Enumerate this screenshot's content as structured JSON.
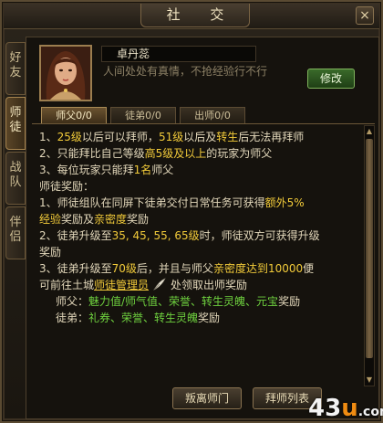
{
  "window": {
    "title": "社 交",
    "close_label": "×"
  },
  "side_tabs": [
    {
      "label": [
        "好",
        "友"
      ]
    },
    {
      "label": [
        "师",
        "徒"
      ]
    },
    {
      "label": [
        "战",
        "队"
      ]
    },
    {
      "label": [
        "伴",
        "侣"
      ]
    }
  ],
  "profile": {
    "name": "卓丹蕊",
    "signature": "人间处处有真情，不抢经验行不行",
    "edit_label": "修改"
  },
  "tabs": [
    {
      "label": "师父0/0"
    },
    {
      "label": "徒弟0/0"
    },
    {
      "label": "出师0/0"
    }
  ],
  "rules": {
    "r1": [
      "1、",
      "25级",
      "以后可以拜师，",
      "51级",
      "以后及",
      "转生",
      "后无法再拜师"
    ],
    "r2": [
      "2、只能拜比自己等级",
      "高5级及以上",
      "的玩家为师父"
    ],
    "r3": [
      "3、每位玩家只能拜",
      "1名",
      "师父"
    ],
    "reward_title": "师徒奖励：",
    "r4": [
      "1、师徒组队在同屏下徒弟交付日常任务可获得",
      "额外5%"
    ],
    "r4b": [
      "经验",
      "奖励及",
      "亲密度",
      "奖励"
    ],
    "r5": [
      "2、徒弟升级至",
      "35, 45, 55, 65级",
      "时，师徒双方可获得升级"
    ],
    "r5b": "奖励",
    "r6": [
      "3、徒弟升级至",
      "70级",
      "后，并且与师父",
      "亲密度达到10000",
      "便"
    ],
    "r6b": [
      "可前往土城",
      "师徒管理员",
      "处领取出师奖励"
    ],
    "r7": [
      "师父：",
      "魅力值/师气值、荣誉、转生灵魄、元宝",
      "奖励"
    ],
    "r8": [
      "徒弟：",
      "礼券、荣誉、转生灵魄",
      "奖励"
    ]
  },
  "buttons": {
    "leave_master": "叛离师门",
    "master_list": "拜师列表"
  },
  "watermark": {
    "digits": "43",
    "letter": "u",
    "rest": ".com"
  },
  "colors": {
    "highlight": "#f2cb3a",
    "green": "#6fd23f"
  }
}
